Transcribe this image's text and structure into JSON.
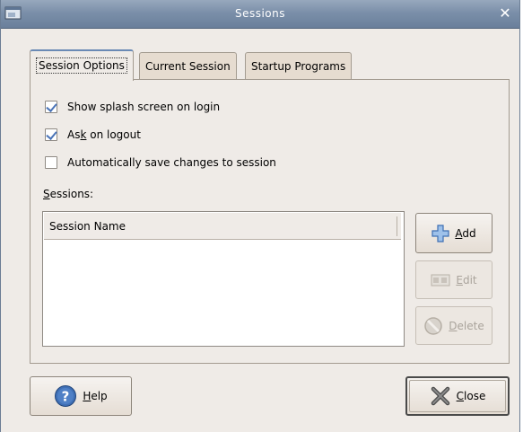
{
  "window": {
    "title": "Sessions",
    "close_symbol": "✕"
  },
  "tabs": [
    {
      "label": "Session Options",
      "active": true
    },
    {
      "label": "Current Session",
      "active": false
    },
    {
      "label": "Startup Programs",
      "active": false
    }
  ],
  "options": [
    {
      "label": "Show splash screen on login",
      "checked": true
    },
    {
      "label_pre": "As",
      "label_u": "k",
      "label_post": " on logout",
      "checked": true
    },
    {
      "label": "Automatically save changes to session",
      "checked": false
    }
  ],
  "sessions": {
    "label_u": "S",
    "label_rest": "essions:",
    "column_header": "Session Name",
    "rows": []
  },
  "buttons": {
    "add": {
      "u": "A",
      "rest": "dd",
      "icon": "plus-icon",
      "enabled": true
    },
    "edit": {
      "u": "E",
      "rest": "dit",
      "icon": "edit-icon",
      "enabled": false
    },
    "delete": {
      "u": "D",
      "rest": "elete",
      "icon": "delete-icon",
      "enabled": false
    },
    "help": {
      "u": "H",
      "rest": "elp",
      "icon": "help-icon"
    },
    "close": {
      "pre": "",
      "u": "C",
      "rest": "lose",
      "icon": "close-x-icon"
    }
  },
  "colors": {
    "titlebar": "#7b8fa9",
    "accent": "#4a74b8",
    "dialog_bg": "#efebe7"
  }
}
